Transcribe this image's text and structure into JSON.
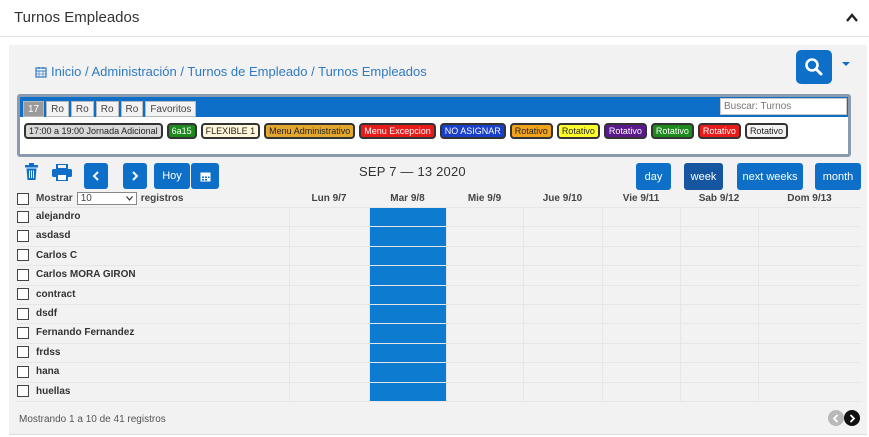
{
  "header": {
    "title": "Turnos Empleados"
  },
  "breadcrumb": "Inicio / Administración / Turnos de Empleado / Turnos Empleados",
  "tabs": [
    "17",
    "Ro",
    "Ro",
    "Ro",
    "Ro",
    "Favoritos"
  ],
  "search_shifts": {
    "placeholder": "Buscar: Turnos"
  },
  "shifts": [
    {
      "label": "17:00 a 19:00 Jornada Adicional",
      "bg": "#d9d9d9",
      "fg": "#222"
    },
    {
      "label": "6a15",
      "bg": "#1c8a1c",
      "fg": "#ffffff"
    },
    {
      "label": "FLEXIBLE 1",
      "bg": "#fff6d9",
      "fg": "#222"
    },
    {
      "label": "Menu Administrativo",
      "bg": "#e4a72e",
      "fg": "#222"
    },
    {
      "label": "Menu Excepcion",
      "bg": "#e81b1b",
      "fg": "#ffffff"
    },
    {
      "label": "NO ASIGNAR",
      "bg": "#1a3fc8",
      "fg": "#ffffff"
    },
    {
      "label": "Rotativo",
      "bg": "#f0a31b",
      "fg": "#222"
    },
    {
      "label": "Rotativo",
      "bg": "#ffff2a",
      "fg": "#222"
    },
    {
      "label": "Rotativo",
      "bg": "#5a1a8c",
      "fg": "#ffffff"
    },
    {
      "label": "Rotativo",
      "bg": "#1c8a1c",
      "fg": "#ffffff"
    },
    {
      "label": "Rotativo",
      "bg": "#e81b1b",
      "fg": "#ffffff"
    },
    {
      "label": "Rotativo",
      "bg": "#f2f2f2",
      "fg": "#222"
    }
  ],
  "toolbar": {
    "today_label": "Hoy"
  },
  "date_range": "SEP 7 — 13 2020",
  "views": {
    "day": "day",
    "week": "week",
    "next_weeks": "next weeks",
    "month": "month"
  },
  "table": {
    "show_label": "Mostrar",
    "page_length": "10",
    "records_label": "registros",
    "columns": [
      "Lun 9/7",
      "Mar 9/8",
      "Mie 9/9",
      "Jue 9/10",
      "Vie 9/11",
      "Sab 9/12",
      "Dom 9/13"
    ],
    "employees": [
      "alejandro",
      "asdasd",
      "Carlos C",
      "Carlos MORA GIRON",
      "contract",
      "dsdf",
      "Fernando Fernandez",
      "frdss",
      "hana",
      "huellas"
    ]
  },
  "footer": {
    "info": "Mostrando 1 a 10 de 41 registros"
  },
  "colors": {
    "primary": "#0d6fc7",
    "today_column": "#0d7bd0"
  }
}
